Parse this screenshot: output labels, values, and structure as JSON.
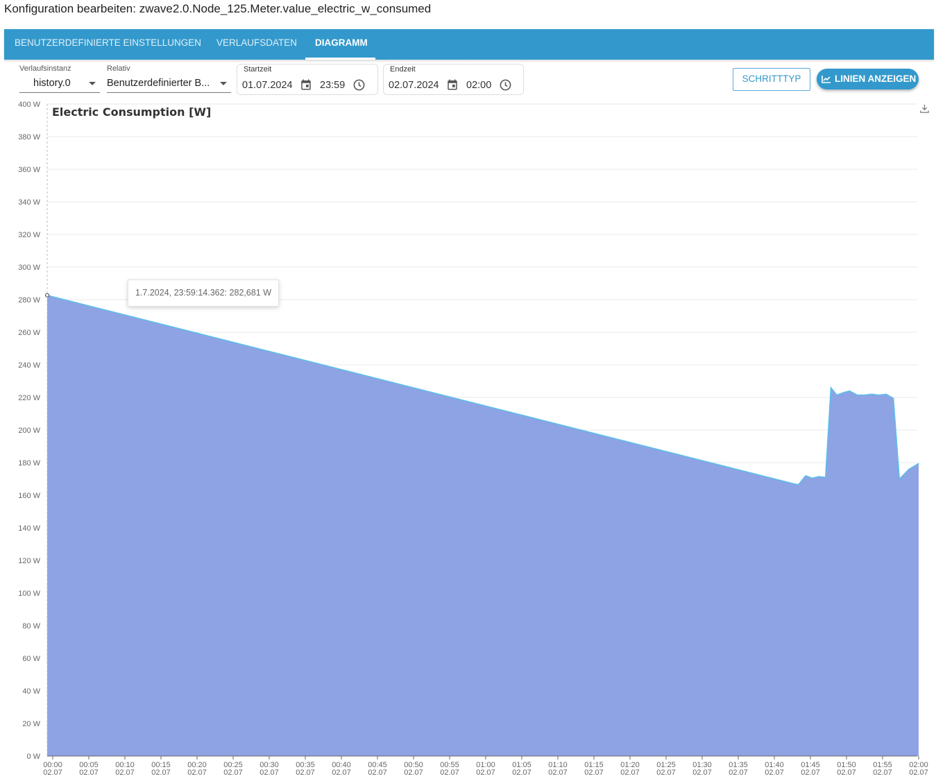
{
  "window": {
    "title": "Konfiguration bearbeiten: zwave2.0.Node_125.Meter.value_electric_w_consumed"
  },
  "tabs": [
    {
      "label": "Benutzerdefinierte Einstellungen",
      "active": false
    },
    {
      "label": "Verlaufsdaten",
      "active": false
    },
    {
      "label": "Diagramm",
      "active": true
    }
  ],
  "toolbar": {
    "history_instance": {
      "label": "Verlaufsinstanz",
      "value": "history.0"
    },
    "relative": {
      "label": "Relativ",
      "value": "Benutzerdefinierter B..."
    },
    "start": {
      "label": "Startzeit",
      "date": "01.07.2024",
      "time": "23:59"
    },
    "end": {
      "label": "Endzeit",
      "date": "02.07.2024",
      "time": "02:00"
    },
    "step_type_label": "Schritttyp",
    "show_lines_label": "Linien anzeigen"
  },
  "tooltip": {
    "text": "1.7.2024, 23:59:14.362: 282,681 W"
  },
  "colors": {
    "accent": "#3399cc",
    "area_fill": "#8da3e3",
    "line": "#5bc0eb"
  },
  "chart_data": {
    "type": "area",
    "title": "Electric Consumption [W]",
    "ylim": [
      0,
      400
    ],
    "y_ticks": [
      0,
      20,
      40,
      60,
      80,
      100,
      120,
      140,
      160,
      180,
      200,
      220,
      240,
      260,
      280,
      300,
      320,
      340,
      360,
      380,
      400
    ],
    "y_unit": "W",
    "grid": true,
    "x_tick_times": [
      "00:00",
      "00:05",
      "00:10",
      "00:15",
      "00:20",
      "00:25",
      "00:30",
      "00:35",
      "00:40",
      "00:45",
      "00:50",
      "00:55",
      "01:00",
      "01:05",
      "01:10",
      "01:15",
      "01:20",
      "01:25",
      "01:30",
      "01:35",
      "01:40",
      "01:45",
      "01:50",
      "01:55",
      "02:00"
    ],
    "x_tick_date": "02.07",
    "series": [
      {
        "points": [
          [
            "2024-07-01 23:59:14",
            282.681
          ],
          [
            "2024-07-02 01:42:45",
            167
          ],
          [
            "2024-07-02 01:43:20",
            166.5
          ],
          [
            "2024-07-02 01:44:20",
            172
          ],
          [
            "2024-07-02 01:45:15",
            170.5
          ],
          [
            "2024-07-02 01:46:10",
            171.5
          ],
          [
            "2024-07-02 01:47:05",
            171
          ],
          [
            "2024-07-02 01:47:50",
            226
          ],
          [
            "2024-07-02 01:48:40",
            221.5
          ],
          [
            "2024-07-02 01:49:35",
            223
          ],
          [
            "2024-07-02 01:50:25",
            224
          ],
          [
            "2024-07-02 01:51:30",
            221.5
          ],
          [
            "2024-07-02 01:52:30",
            221.5
          ],
          [
            "2024-07-02 01:53:30",
            222
          ],
          [
            "2024-07-02 01:54:30",
            221.5
          ],
          [
            "2024-07-02 01:55:30",
            222
          ],
          [
            "2024-07-02 01:56:30",
            219.5
          ],
          [
            "2024-07-02 01:57:20",
            170
          ],
          [
            "2024-07-02 01:58:40",
            176
          ],
          [
            "2024-07-02 02:00:00",
            179.5
          ]
        ]
      }
    ]
  }
}
